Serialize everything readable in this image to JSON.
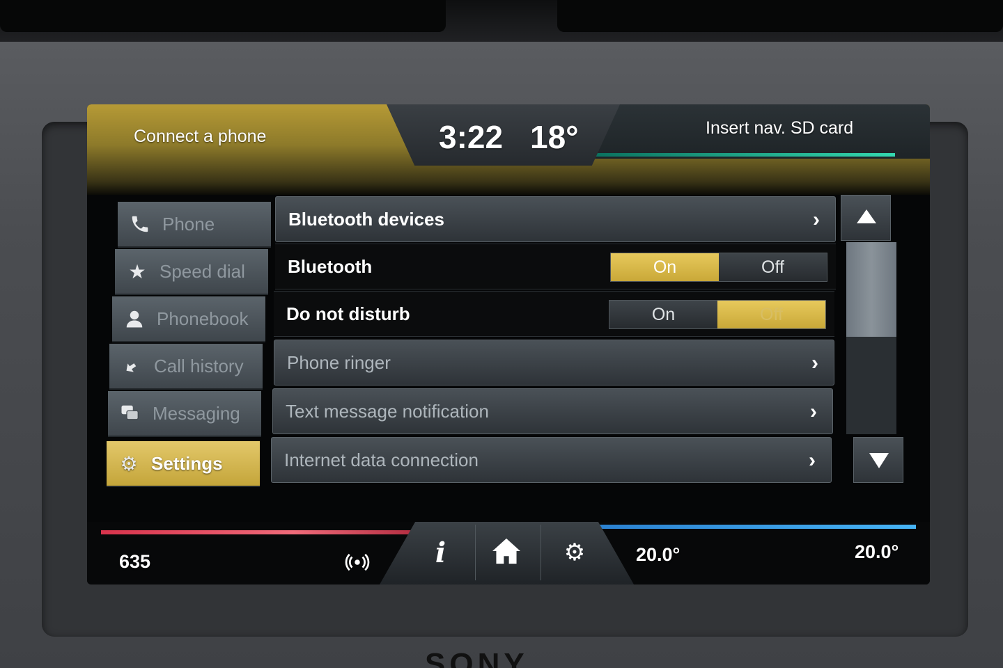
{
  "header": {
    "left_status": "Connect a phone",
    "time": "3:22",
    "outside_temp": "18°",
    "right_status": "Insert nav. SD card"
  },
  "sidebar": {
    "items": [
      {
        "label": "Phone",
        "icon": "phone-icon"
      },
      {
        "label": "Speed dial",
        "icon": "star-icon"
      },
      {
        "label": "Phonebook",
        "icon": "person-icon"
      },
      {
        "label": "Call history",
        "icon": "call-history-icon"
      },
      {
        "label": "Messaging",
        "icon": "chat-bubbles-icon"
      },
      {
        "label": "Settings",
        "icon": "gear-icon",
        "active": true
      }
    ]
  },
  "settings": {
    "rows": [
      {
        "label": "Bluetooth devices",
        "type": "nav"
      },
      {
        "label": "Bluetooth",
        "type": "toggle",
        "on_label": "On",
        "off_label": "Off",
        "selected": "On"
      },
      {
        "label": "Do not disturb",
        "type": "toggle",
        "on_label": "On",
        "off_label": "Off",
        "selected": "Off"
      },
      {
        "label": "Phone ringer",
        "type": "nav"
      },
      {
        "label": "Text message notification",
        "type": "nav"
      },
      {
        "label": "Internet data connection",
        "type": "nav"
      }
    ]
  },
  "footer": {
    "left_value": "635",
    "driver_temp": "20.0°",
    "passenger_temp": "20.0°",
    "icons": [
      "radio-signal-icon",
      "info-icon",
      "home-icon",
      "settings-gears-icon"
    ]
  },
  "colors": {
    "accent_gold": "#d7b84b",
    "teal": "#34d9b0",
    "red": "#e8485d",
    "blue": "#3fa6ec"
  },
  "bezel": {
    "brand": "SONY"
  }
}
